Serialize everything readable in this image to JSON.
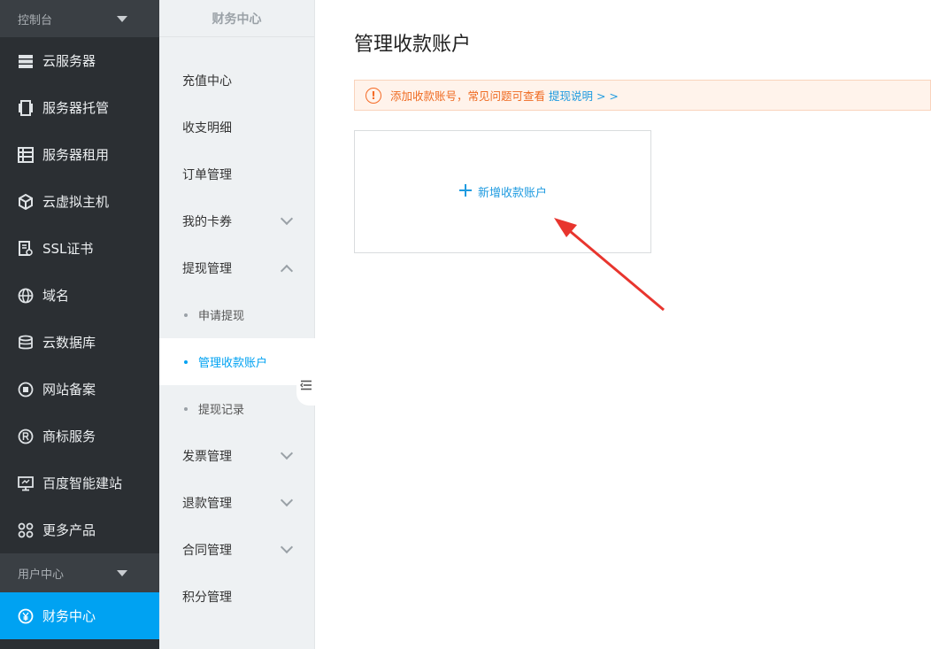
{
  "sidebar": {
    "console_label": "控制台",
    "items": [
      {
        "label": "云服务器",
        "icon": "server-icon"
      },
      {
        "label": "服务器托管",
        "icon": "hosting-icon"
      },
      {
        "label": "服务器租用",
        "icon": "rent-icon"
      },
      {
        "label": "云虚拟主机",
        "icon": "cube-icon"
      },
      {
        "label": "SSL证书",
        "icon": "certificate-icon"
      },
      {
        "label": "域名",
        "icon": "globe-icon"
      },
      {
        "label": "云数据库",
        "icon": "database-icon"
      },
      {
        "label": "网站备案",
        "icon": "record-icon"
      },
      {
        "label": "商标服务",
        "icon": "trademark-icon"
      },
      {
        "label": "百度智能建站",
        "icon": "monitor-icon"
      },
      {
        "label": "更多产品",
        "icon": "grid-icon"
      }
    ],
    "user_center_label": "用户中心",
    "finance_label": "财务中心",
    "active_color": "#00a2f2"
  },
  "submenu": {
    "title": "财务中心",
    "recharge": "充值中心",
    "billing": "收支明细",
    "orders": "订单管理",
    "coupons": "我的卡券",
    "withdraw": "提现管理",
    "withdraw_apply": "申请提现",
    "withdraw_accounts": "管理收款账户",
    "withdraw_records": "提现记录",
    "invoice": "发票管理",
    "refund": "退款管理",
    "contract": "合同管理",
    "points": "积分管理"
  },
  "main": {
    "title": "管理收款账户",
    "notice_text": "添加收款账号，常见问题可查看",
    "notice_link": "提现说明 > >",
    "add_label": "新增收款账户"
  }
}
